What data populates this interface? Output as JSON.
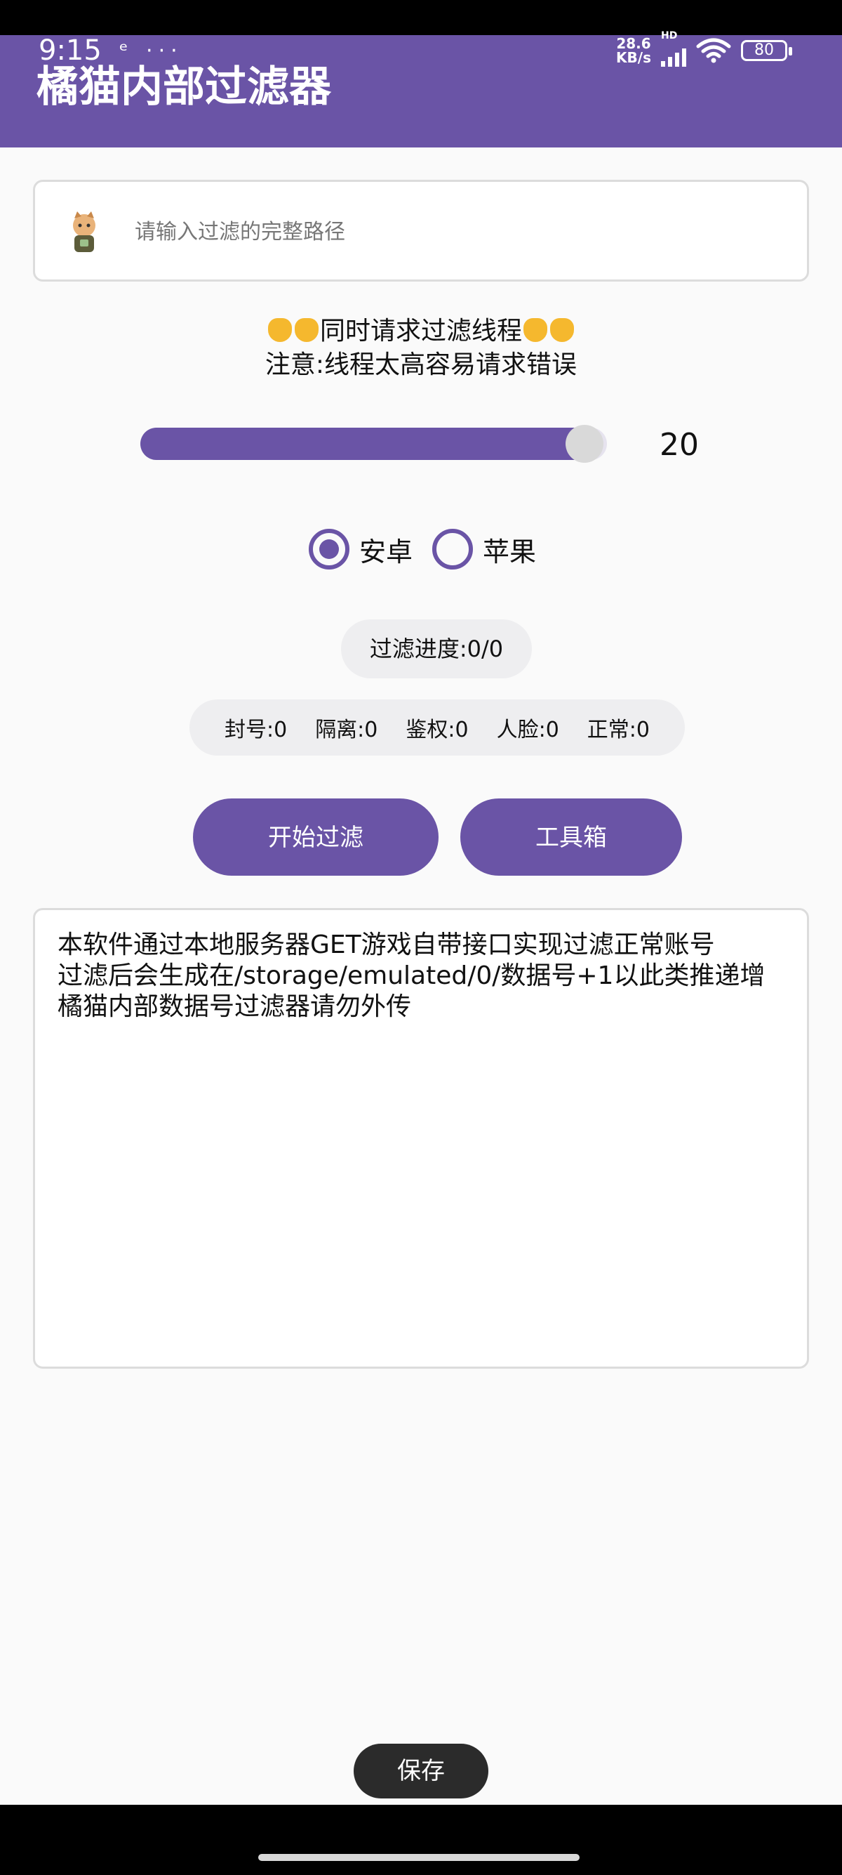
{
  "status_bar": {
    "time": "9:15",
    "left_icons": "ᵉ ···",
    "speed_value": "28.6",
    "speed_unit": "KB/s",
    "network": "HD",
    "battery": "80"
  },
  "app": {
    "title": "橘猫内部过滤器"
  },
  "path_input": {
    "placeholder": "请输入过滤的完整路径",
    "value": ""
  },
  "notice": {
    "line1": "同时请求过滤线程",
    "line2": "注意:线程太高容易请求错误",
    "emoji_color": "#f5b82e"
  },
  "slider": {
    "value": "20",
    "level": 20,
    "max": 21
  },
  "platform": {
    "options": [
      "安卓",
      "苹果"
    ],
    "selected": "安卓"
  },
  "progress": {
    "text": "过滤进度:0/0"
  },
  "stats": {
    "banned": "封号:0",
    "isolated": "隔离:0",
    "auth": "鉴权:0",
    "face": "人脸:0",
    "normal": "正常:0"
  },
  "buttons": {
    "start": "开始过滤",
    "toolbox": "工具箱"
  },
  "log": {
    "lines": [
      "本软件通过本地服务器GET游戏自带接口实现过滤正常账号",
      "过滤后会生成在/storage/emulated/0/数据号+1以此类推递增",
      "橘猫内部数据号过滤器请勿外传"
    ]
  },
  "toast": {
    "text": "保存"
  },
  "colors": {
    "primary": "#6a54a6",
    "background": "#fafafa"
  }
}
